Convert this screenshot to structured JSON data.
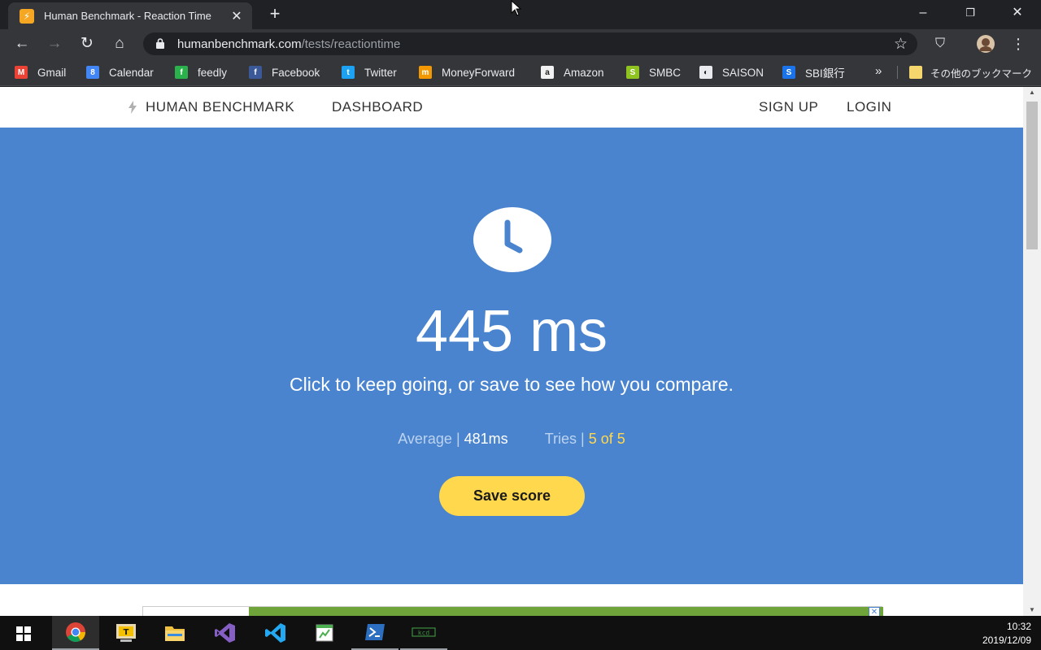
{
  "browser": {
    "tab_title": "Human Benchmark - Reaction Time",
    "favicon_icon": "lightning-icon",
    "url_host": "humanbenchmark.com",
    "url_path": "/tests/reactiontime",
    "bookmarks": [
      {
        "label": "Gmail",
        "icon": "gmail-icon",
        "color": "#ea4335",
        "glyph": "M"
      },
      {
        "label": "Calendar",
        "icon": "calendar-icon",
        "color": "#4285f4",
        "glyph": "8"
      },
      {
        "label": "feedly",
        "icon": "feedly-icon",
        "color": "#2bb24c",
        "glyph": "f"
      },
      {
        "label": "Facebook",
        "icon": "facebook-icon",
        "color": "#3b5998",
        "glyph": "f"
      },
      {
        "label": "Twitter",
        "icon": "twitter-icon",
        "color": "#1da1f2",
        "glyph": "t"
      },
      {
        "label": "MoneyForward",
        "icon": "moneyforward-icon",
        "color": "#f39800",
        "glyph": "m"
      },
      {
        "label": "Amazon",
        "icon": "amazon-icon",
        "color": "#f2f2f2",
        "glyph": "a"
      },
      {
        "label": "SMBC",
        "icon": "smbc-icon",
        "color": "#8fc31f",
        "glyph": "S"
      },
      {
        "label": "SAISON",
        "icon": "saison-icon",
        "color": "#e8eaed",
        "glyph": "◐"
      },
      {
        "label": "SBI銀行",
        "icon": "sbi-icon",
        "color": "#1a73e8",
        "glyph": "S"
      }
    ],
    "other_bookmarks": "その他のブックマーク"
  },
  "site": {
    "brand": "HUMAN BENCHMARK",
    "nav": {
      "dashboard": "DASHBOARD",
      "signup": "SIGN UP",
      "login": "LOGIN"
    }
  },
  "result": {
    "score": "445 ms",
    "message": "Click to keep going, or save to see how you compare.",
    "average_label": "Average",
    "average_value": "481ms",
    "tries_label": "Tries",
    "tries_value": "5 of 5",
    "save_button": "Save score"
  },
  "colors": {
    "hero_bg": "#4a84cf",
    "accent_yellow": "#ffd84d"
  },
  "taskbar": {
    "apps": [
      "chrome-icon",
      "typora-icon",
      "file-explorer-icon",
      "visual-studio-icon",
      "vscode-icon",
      "notepad-icon",
      "powershell-icon",
      "terminal-icon"
    ],
    "time": "10:32",
    "date": "2019/12/09"
  }
}
